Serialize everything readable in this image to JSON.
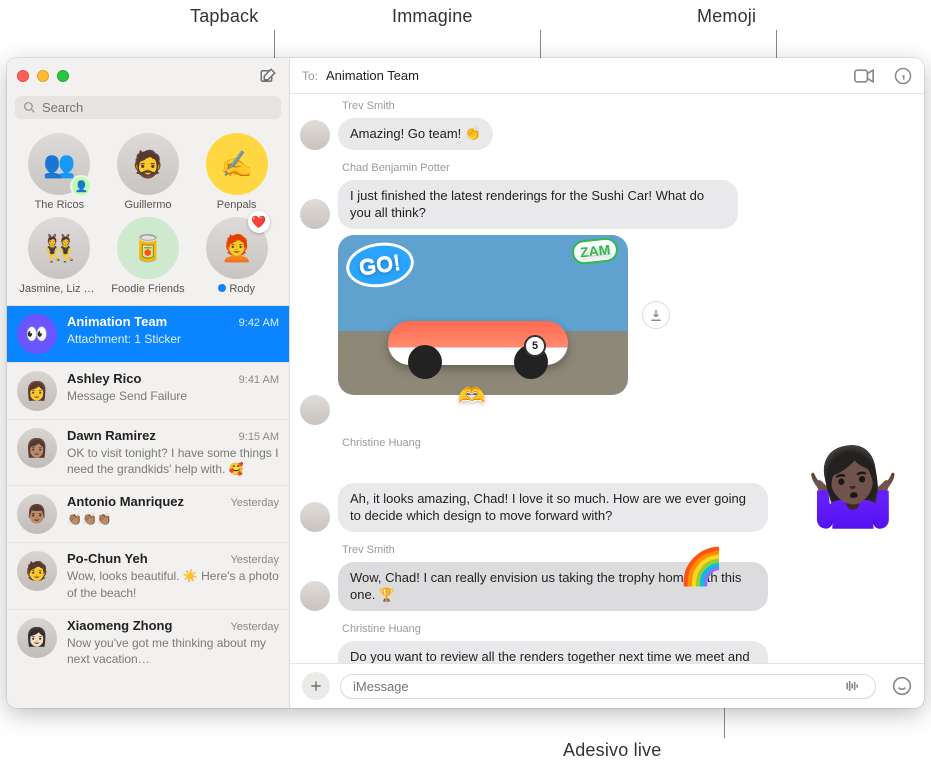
{
  "callouts": {
    "tapback": "Tapback",
    "image": "Immagine",
    "memoji": "Memoji",
    "live_sticker": "Adesivo live"
  },
  "search": {
    "placeholder": "Search"
  },
  "pinned": [
    {
      "label": "The Ricos",
      "emoji": "👥",
      "has_sub": true
    },
    {
      "label": "Guillermo",
      "emoji": "🧔"
    },
    {
      "label": "Penpals",
      "emoji": "✍️",
      "bubble_bg": "#ffd740"
    },
    {
      "label": "Jasmine, Liz &…",
      "emoji": "👯"
    },
    {
      "label": "Foodie Friends",
      "emoji": "🥫",
      "bubble_bg": "#cfe9cf"
    },
    {
      "label": "Rody",
      "emoji": "🧑‍🦰",
      "unread": true,
      "tapback": "❤️"
    }
  ],
  "conversations": [
    {
      "name": "Animation Team",
      "time": "9:42 AM",
      "preview": "Attachment: 1 Sticker",
      "selected": true,
      "avatar": "👀",
      "group_bg": "#6a55ff"
    },
    {
      "name": "Ashley Rico",
      "time": "9:41 AM",
      "preview": "Message Send Failure",
      "avatar": "👩"
    },
    {
      "name": "Dawn Ramirez",
      "time": "9:15 AM",
      "preview": "OK to visit tonight? I have some things I need the grandkids' help with. 🥰",
      "avatar": "👩🏽"
    },
    {
      "name": "Antonio Manriquez",
      "time": "Yesterday",
      "preview": "👏🏽👏🏽👏🏽",
      "avatar": "👨🏽"
    },
    {
      "name": "Po-Chun Yeh",
      "time": "Yesterday",
      "preview": "Wow, looks beautiful. ☀️ Here's a photo of the beach!",
      "avatar": "🧑"
    },
    {
      "name": "Xiaomeng Zhong",
      "time": "Yesterday",
      "preview": "Now you've got me thinking about my next vacation…",
      "avatar": "👩🏻"
    }
  ],
  "header": {
    "to_label": "To:",
    "to_name": "Animation Team"
  },
  "thread": {
    "m0_sender": "Trev Smith",
    "m0_text": "Amazing! Go team! 👏",
    "m1_sender": "Chad Benjamin Potter",
    "m1_text": "I just finished the latest renderings for the Sushi Car! What do you all think?",
    "image": {
      "go": "GO!",
      "zam": "ZAM",
      "num": "5"
    },
    "m2_sender": "Christine Huang",
    "m2_text": "Ah, it looks amazing, Chad! I love it so much. How are we ever going to decide which design to move forward with?",
    "m3_sender": "Trev Smith",
    "m3_text": "Wow, Chad! I can really envision us taking the trophy home with this one. 🏆",
    "m4_sender": "Christine Huang",
    "m4_text": "Do you want to review all the renders together next time we meet and decide on our favorites? We have so much amazing work now, just need to make some decisions."
  },
  "composer": {
    "placeholder": "iMessage"
  }
}
